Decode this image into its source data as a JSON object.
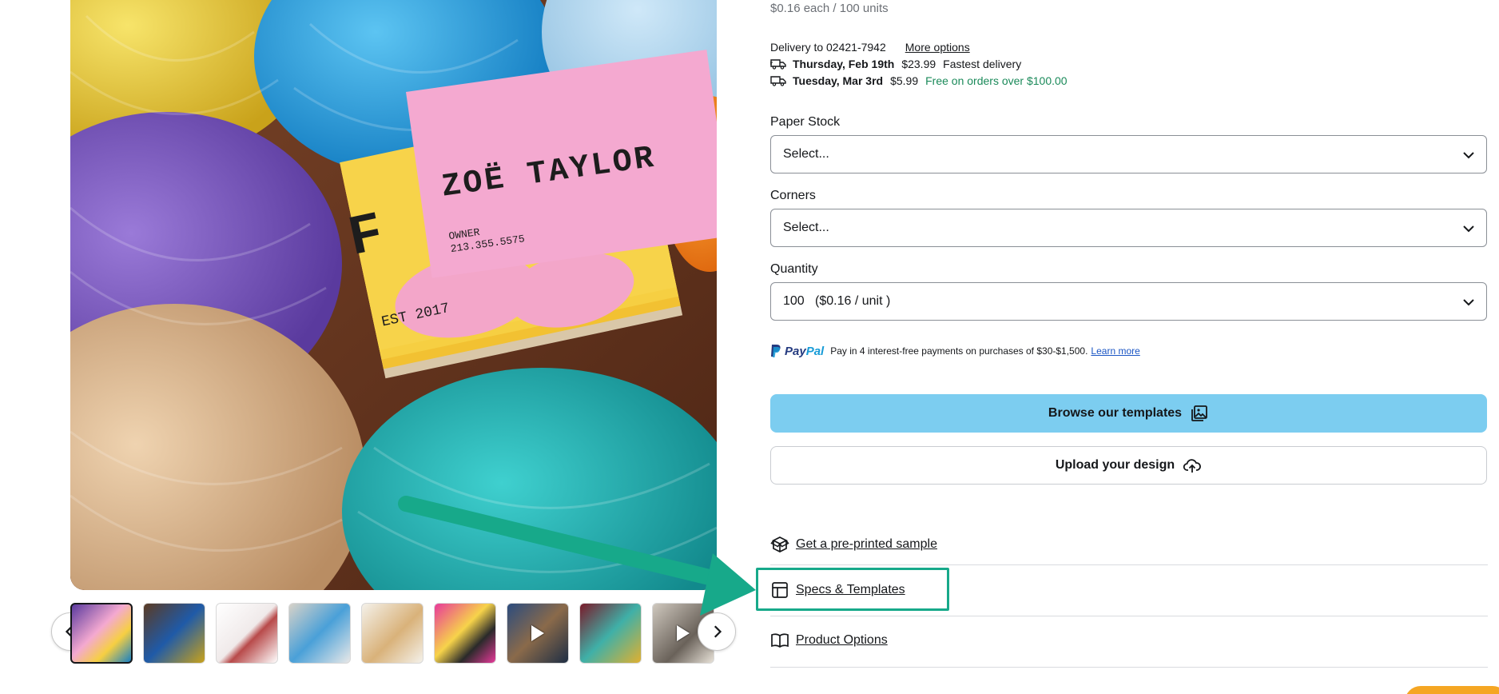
{
  "product": {
    "price_line": "$0.16 each / 100 units",
    "card_name": "ZOË TAYLOR",
    "card_role": "OWNER",
    "card_phone": "213.355.5575",
    "card_est": "EST 2017"
  },
  "delivery": {
    "label": "Delivery to 02421-7942",
    "more_options": "More options",
    "options": [
      {
        "date": "Thursday, Feb 19th",
        "price": "$23.99",
        "note": "Fastest delivery"
      },
      {
        "date": "Tuesday, Mar 3rd",
        "price": "$5.99",
        "note": "Free on orders over $100.00"
      }
    ]
  },
  "fields": {
    "paper_stock": {
      "label": "Paper Stock",
      "value": "Select..."
    },
    "corners": {
      "label": "Corners",
      "value": "Select..."
    },
    "quantity": {
      "label": "Quantity",
      "value": "100   ($0.16 / unit )"
    }
  },
  "paypal": {
    "brand": "PayPal",
    "text": "Pay in 4 interest-free payments on purchases of $30-$1,500.",
    "learn_more": "Learn more"
  },
  "buttons": {
    "browse": "Browse our templates",
    "upload": "Upload your design"
  },
  "links": {
    "sample": "Get a pre-printed sample",
    "specs": "Specs & Templates",
    "options": "Product Options"
  },
  "colors": {
    "primary_button": "#7ccdf0",
    "highlight": "#17a98a",
    "free_text": "#1b8a5a"
  }
}
